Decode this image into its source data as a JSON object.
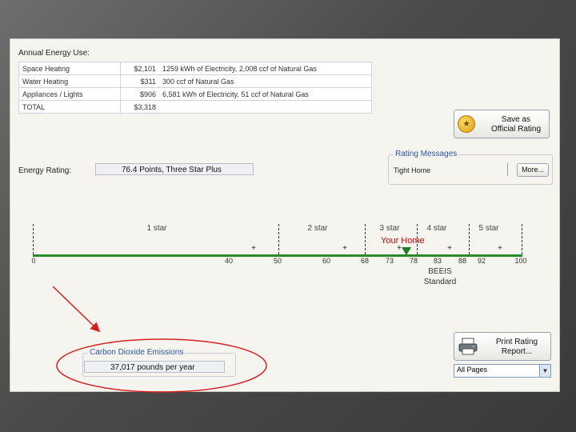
{
  "energy_use": {
    "title": "Annual Energy Use:",
    "rows": [
      {
        "category": "Space Heating",
        "cost": "$2,101",
        "detail": "1259 kWh of Electricity, 2,008 ccf of Natural Gas"
      },
      {
        "category": "Water Heating",
        "cost": "$311",
        "detail": "300 ccf of Natural Gas"
      },
      {
        "category": "Appliances / Lights",
        "cost": "$906",
        "detail": "6,581 kWh of Electricity, 51 ccf of Natural Gas"
      },
      {
        "category": "TOTAL",
        "cost": "$3,318",
        "detail": ""
      }
    ]
  },
  "save_button": {
    "line1": "Save as",
    "line2": "Official Rating",
    "icon": "seal-icon"
  },
  "rating_messages": {
    "title": "Rating Messages",
    "message": "Tight Home",
    "more_label": "More..."
  },
  "energy_rating": {
    "label": "Energy Rating:",
    "value": "76.4 Points, Three Star Plus"
  },
  "scale": {
    "stars": [
      "1 star",
      "2 star",
      "3 star",
      "4 star",
      "5 star"
    ],
    "ticks": [
      "0",
      "40",
      "50",
      "60",
      "68",
      "73",
      "78",
      "83",
      "88",
      "92",
      "100"
    ],
    "your_home_label": "Your Home",
    "your_home_score": 76.4,
    "beeis_label": "BEEIS",
    "standard_label": "Standard",
    "line_color": "#2a8a2a",
    "marker_color": "#1e7d1e",
    "highlight_color": "#cc0000"
  },
  "co2": {
    "title": "Carbon Dioxide Emissions",
    "value": "37,017 pounds per year"
  },
  "print_button": {
    "line1": "Print Rating",
    "line2": "Report...",
    "icon": "printer-icon"
  },
  "page_select": {
    "selected": "All Pages"
  }
}
